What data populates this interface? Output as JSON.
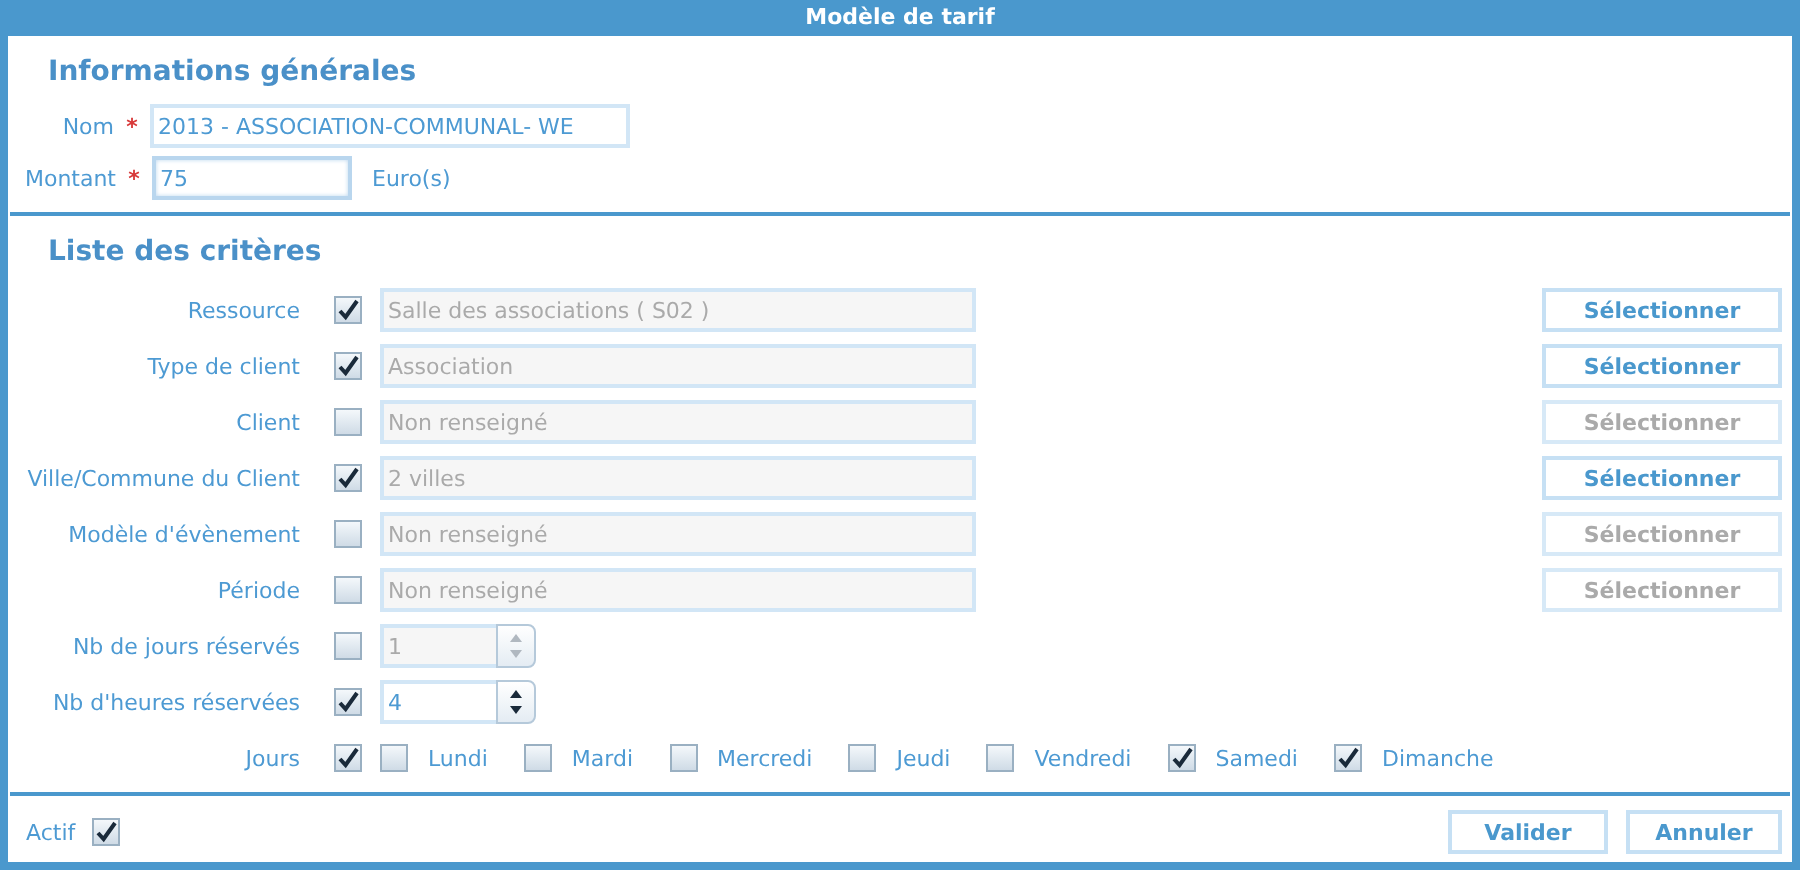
{
  "window": {
    "title": "Modèle de tarif"
  },
  "general": {
    "heading": "Informations générales",
    "fields": [
      {
        "kind": "text",
        "label": "Nom",
        "required_mark": "*",
        "value": "2013 - ASSOCIATION-COMMUNAL- WE",
        "focused": false
      },
      {
        "kind": "amount",
        "label": "Montant",
        "required_mark": "*",
        "value": "75",
        "unit": "Euro(s)",
        "focused": true
      }
    ]
  },
  "criteria": {
    "heading": "Liste des critères",
    "rows": [
      {
        "kind": "select",
        "label": "Ressource",
        "checked": true,
        "value": "Salle des associations ( S02 )",
        "button": {
          "label": "Sélectionner",
          "disabled": false
        }
      },
      {
        "kind": "select",
        "label": "Type de client",
        "checked": true,
        "value": "Association",
        "button": {
          "label": "Sélectionner",
          "disabled": false
        }
      },
      {
        "kind": "select",
        "label": "Client",
        "checked": false,
        "value": "Non renseigné",
        "button": {
          "label": "Sélectionner",
          "disabled": true
        }
      },
      {
        "kind": "select",
        "label": "Ville/Commune du Client",
        "checked": true,
        "value": "2 villes",
        "button": {
          "label": "Sélectionner",
          "disabled": false
        }
      },
      {
        "kind": "select",
        "label": "Modèle d'évènement",
        "checked": false,
        "value": "Non renseigné",
        "button": {
          "label": "Sélectionner",
          "disabled": true
        }
      },
      {
        "kind": "select",
        "label": "Période",
        "checked": false,
        "value": "Non renseigné",
        "button": {
          "label": "Sélectionner",
          "disabled": true
        }
      },
      {
        "kind": "spinner",
        "label": "Nb de jours réservés",
        "checked": false,
        "value": "1"
      },
      {
        "kind": "spinner",
        "label": "Nb d'heures réservées",
        "checked": true,
        "value": "4"
      },
      {
        "kind": "days",
        "label": "Jours",
        "checked": true,
        "days": [
          {
            "label": "Lundi",
            "checked": false
          },
          {
            "label": "Mardi",
            "checked": false
          },
          {
            "label": "Mercredi",
            "checked": false
          },
          {
            "label": "Jeudi",
            "checked": false
          },
          {
            "label": "Vendredi",
            "checked": false
          },
          {
            "label": "Samedi",
            "checked": true
          },
          {
            "label": "Dimanche",
            "checked": true
          }
        ]
      }
    ]
  },
  "footer": {
    "active": {
      "label": "Actif",
      "checked": true
    },
    "buttons": [
      {
        "label": "Valider"
      },
      {
        "label": "Annuler"
      }
    ]
  }
}
